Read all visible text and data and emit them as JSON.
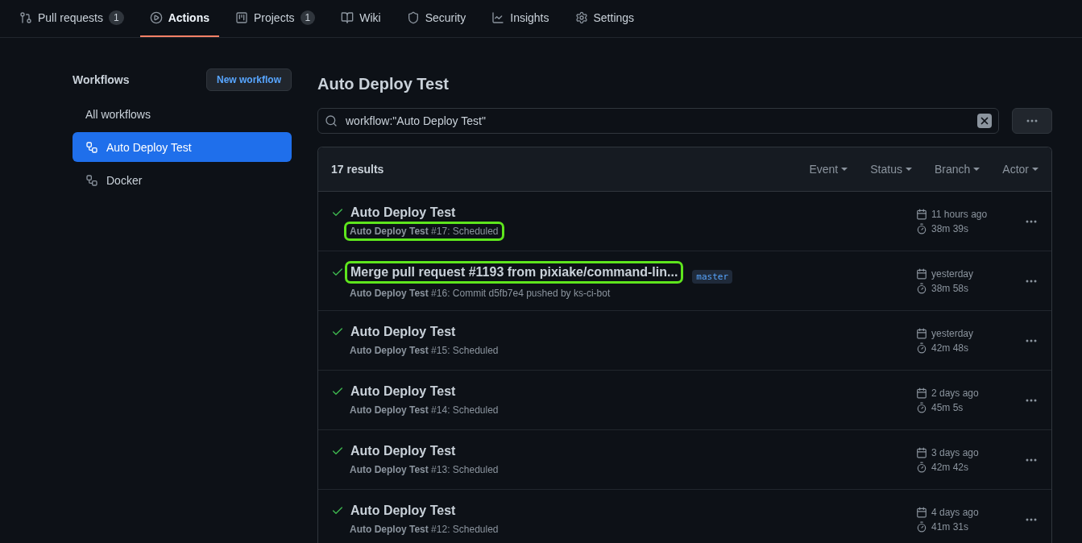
{
  "tabs": [
    {
      "label": "Pull requests",
      "counter": "1",
      "selected": false
    },
    {
      "label": "Actions",
      "selected": true
    },
    {
      "label": "Projects",
      "counter": "1",
      "selected": false
    },
    {
      "label": "Wiki",
      "selected": false
    },
    {
      "label": "Security",
      "selected": false
    },
    {
      "label": "Insights",
      "selected": false
    },
    {
      "label": "Settings",
      "selected": false
    }
  ],
  "sidebar": {
    "title": "Workflows",
    "new_button": "New workflow",
    "items": [
      {
        "label": "All workflows",
        "kind": "all",
        "selected": false
      },
      {
        "label": "Auto Deploy Test",
        "kind": "workflow",
        "selected": true
      },
      {
        "label": "Docker",
        "kind": "workflow",
        "selected": false
      }
    ]
  },
  "main": {
    "title": "Auto Deploy Test",
    "search": {
      "value": "workflow:\"Auto Deploy Test\""
    },
    "results": "17 results",
    "filters": [
      "Event",
      "Status",
      "Branch",
      "Actor"
    ],
    "runs": [
      {
        "title": "Auto Deploy Test",
        "subtitle": "**Auto Deploy Test** #17: Scheduled",
        "date": "11 hours ago",
        "duration": "38m 39s",
        "title_highlighted": false,
        "subtitle_highlighted": true
      },
      {
        "title": "Merge pull request #1193 from pixiake/command-lin...",
        "subtitle": "**Auto Deploy Test** #16: Commit d5fb7e4 pushed by ks-ci-bot",
        "branch": "master",
        "date": "yesterday",
        "duration": "38m 58s",
        "title_highlighted": true,
        "subtitle_highlighted": false
      },
      {
        "title": "Auto Deploy Test",
        "subtitle": "**Auto Deploy Test** #15: Scheduled",
        "date": "yesterday",
        "duration": "42m 48s",
        "title_highlighted": false,
        "subtitle_highlighted": false
      },
      {
        "title": "Auto Deploy Test",
        "subtitle": "**Auto Deploy Test** #14: Scheduled",
        "date": "2 days ago",
        "duration": "45m 5s",
        "title_highlighted": false,
        "subtitle_highlighted": false
      },
      {
        "title": "Auto Deploy Test",
        "subtitle": "**Auto Deploy Test** #13: Scheduled",
        "date": "3 days ago",
        "duration": "42m 42s",
        "title_highlighted": false,
        "subtitle_highlighted": false
      },
      {
        "title": "Auto Deploy Test",
        "subtitle": "**Auto Deploy Test** #12: Scheduled",
        "date": "4 days ago",
        "duration": "41m 31s",
        "title_highlighted": false,
        "subtitle_highlighted": false
      }
    ]
  }
}
